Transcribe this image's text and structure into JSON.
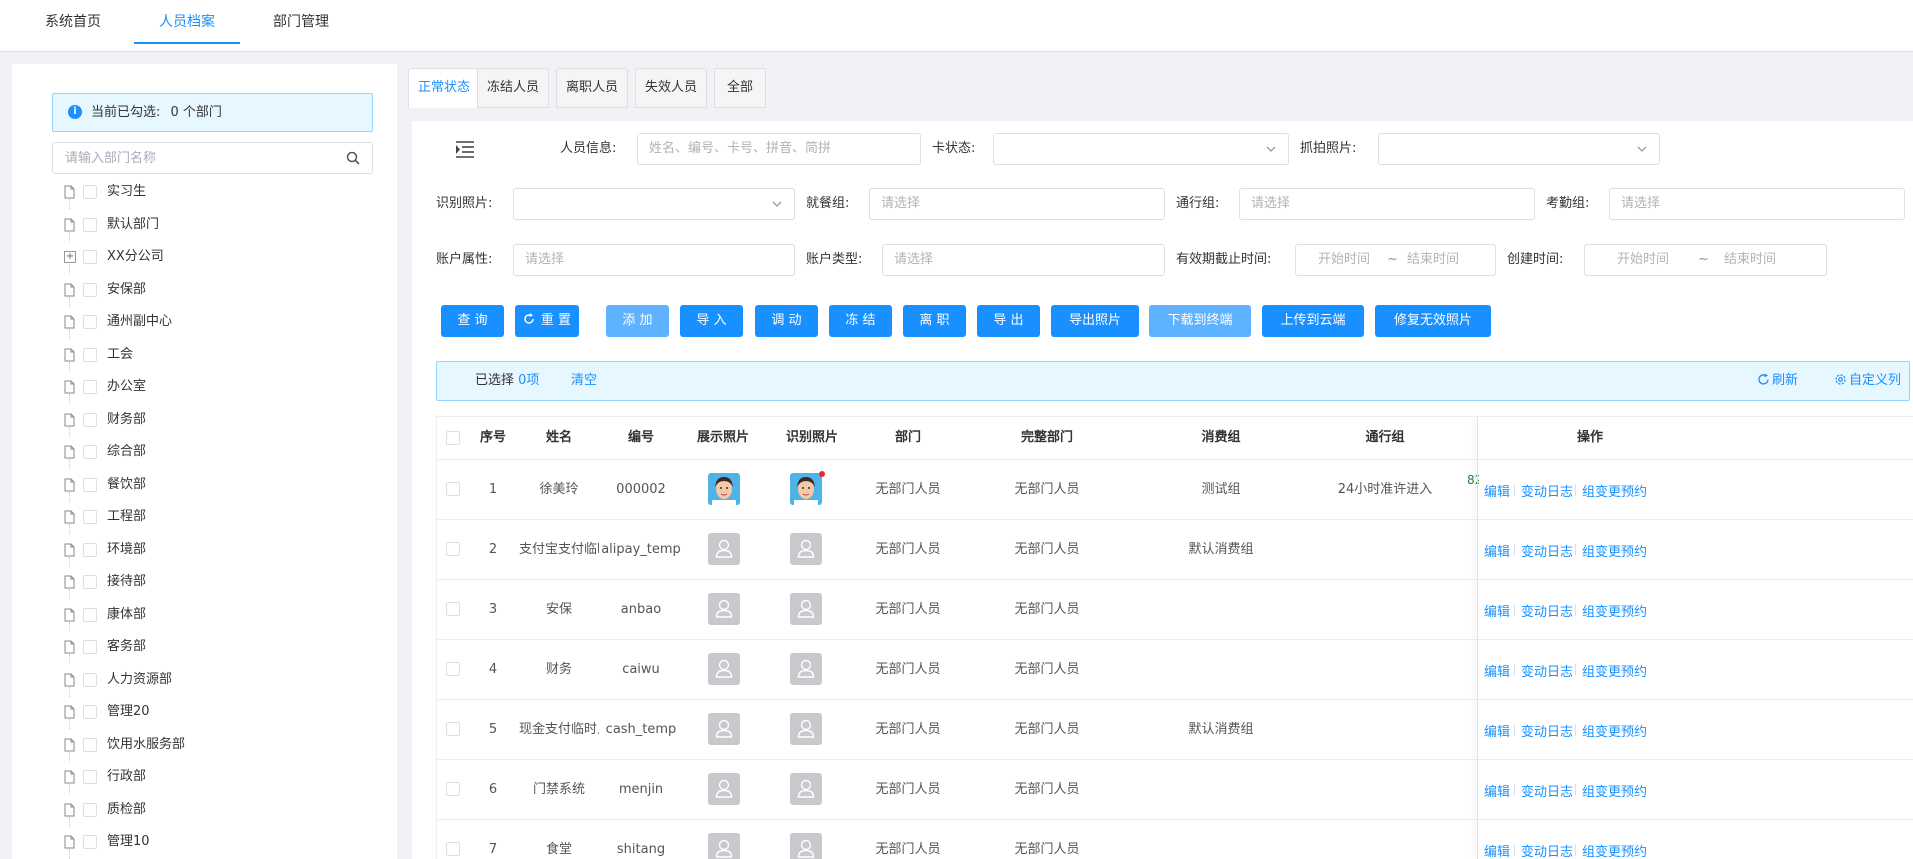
{
  "nav": {
    "items": [
      {
        "label": "系统首页"
      },
      {
        "label": "人员档案"
      },
      {
        "label": "部门管理"
      }
    ]
  },
  "left": {
    "selected_prefix": "当前已勾选:",
    "selected_count": "0 个部门",
    "search_placeholder": "请输入部门名称",
    "tree": [
      "实习生",
      "默认部门",
      "XX分公司",
      "安保部",
      "通州副中心",
      "工会",
      "办公室",
      "财务部",
      "综合部",
      "餐饮部",
      "工程部",
      "环境部",
      "接待部",
      "康体部",
      "客务部",
      "人力资源部",
      "管理20",
      "饮用水服务部",
      "行政部",
      "质检部",
      "管理10"
    ]
  },
  "tabs": [
    "正常状态",
    "冻结人员",
    "离职人员",
    "失效人员",
    "全部"
  ],
  "filters": {
    "person_info": {
      "label": "人员信息:",
      "placeholder": "姓名、编号、卡号、拼音、简拼"
    },
    "card_status": {
      "label": "卡状态:"
    },
    "snap_photo": {
      "label": "抓拍照片:"
    },
    "recog_photo": {
      "label": "识别照片:"
    },
    "meal_group": {
      "label": "就餐组:",
      "placeholder": "请选择"
    },
    "pass_group": {
      "label": "通行组:",
      "placeholder": "请选择"
    },
    "attend_group": {
      "label": "考勤组:",
      "placeholder": "请选择"
    },
    "account_attr": {
      "label": "账户属性:",
      "placeholder": "请选择"
    },
    "account_type": {
      "label": "账户类型:",
      "placeholder": "请选择"
    },
    "valid_until": {
      "label": "有效期截止时间:",
      "start": "开始时间",
      "sep": "~",
      "end": "结束时间"
    },
    "created": {
      "label": "创建时间:",
      "start": "开始时间",
      "sep": "~",
      "end": "结束时间"
    }
  },
  "buttons": [
    "查 询",
    "重 置",
    "添 加",
    "导 入",
    "调 动",
    "冻 结",
    "离 职",
    "导 出",
    "导出照片",
    "下载到终端",
    "上传到云端",
    "修复无效照片"
  ],
  "selbar": {
    "prefix": "已选择",
    "count": "0项",
    "clear": "清空",
    "refresh": "刷新",
    "custom_cols": "自定义列"
  },
  "table": {
    "headers": [
      "序号",
      "姓名",
      "编号",
      "展示照片",
      "识别照片",
      "部门",
      "完整部门",
      "消费组",
      "通行组",
      "操作"
    ],
    "ops": [
      "编辑",
      "变动日志",
      "组变更预约"
    ],
    "rows": [
      {
        "no": "1",
        "name": "徐美玲",
        "code": "000002",
        "photo": true,
        "dept": "无部门人员",
        "full": "无部门人员",
        "consume": "测试组",
        "pass": "24小时准许进入",
        "extra": "82"
      },
      {
        "no": "2",
        "name": "支付宝支付临时",
        "code": "alipay_temp",
        "photo": false,
        "dept": "无部门人员",
        "full": "无部门人员",
        "consume": "默认消费组",
        "pass": "",
        "extra": ""
      },
      {
        "no": "3",
        "name": "安保",
        "code": "anbao",
        "photo": false,
        "dept": "无部门人员",
        "full": "无部门人员",
        "consume": "",
        "pass": "",
        "extra": ""
      },
      {
        "no": "4",
        "name": "财务",
        "code": "caiwu",
        "photo": false,
        "dept": "无部门人员",
        "full": "无部门人员",
        "consume": "",
        "pass": "",
        "extra": ""
      },
      {
        "no": "5",
        "name": "现金支付临时人",
        "code": "cash_temp",
        "photo": false,
        "dept": "无部门人员",
        "full": "无部门人员",
        "consume": "默认消费组",
        "pass": "",
        "extra": ""
      },
      {
        "no": "6",
        "name": "门禁系统",
        "code": "menjin",
        "photo": false,
        "dept": "无部门人员",
        "full": "无部门人员",
        "consume": "",
        "pass": "",
        "extra": ""
      },
      {
        "no": "7",
        "name": "食堂",
        "code": "shitang",
        "photo": false,
        "dept": "无部门人员",
        "full": "无部门人员",
        "consume": "",
        "pass": "",
        "extra": ""
      }
    ]
  },
  "colors": {
    "primary": "#1890ff",
    "primary_light": "#5fb2ff",
    "info_bg": "#e6f7ff",
    "info_border": "#91d5ff",
    "placeholder_photo": "#c8c9cc"
  }
}
